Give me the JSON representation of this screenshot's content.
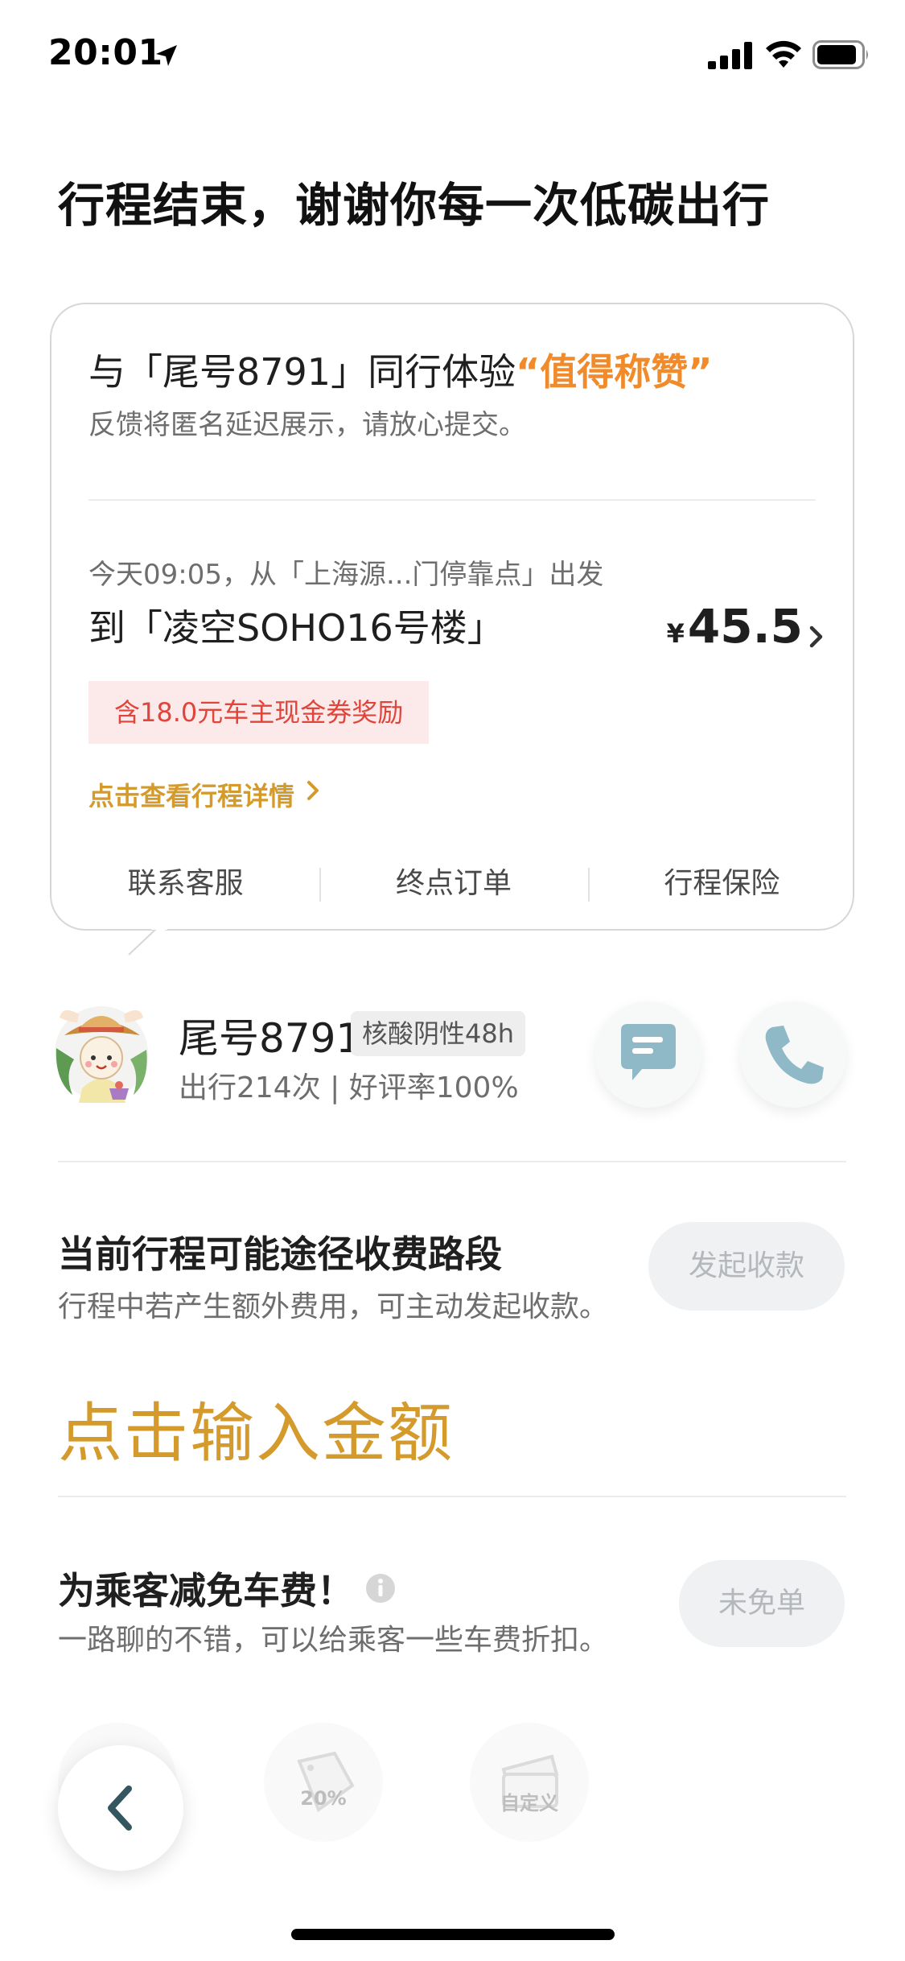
{
  "status_bar": {
    "time": "20:01",
    "icons": [
      "location-arrow-icon",
      "signal-icon",
      "wifi-icon",
      "battery-icon"
    ]
  },
  "page": {
    "title": "行程结束，谢谢你每一次低碳出行"
  },
  "trip_card": {
    "review_prefix": "与「尾号8791」同行体验",
    "review_highlight": "“值得称赞”",
    "review_note": "反馈将匿名延迟展示，请放心提交。",
    "departure": "今天09:05，从「上海源...门停靠点」出发",
    "destination": "到「凌空SOHO16号楼」",
    "price_currency": "¥",
    "price_value": "45.5",
    "coupon_note": "含18.0元车主现金券奖励",
    "detail_link": "点击查看行程详情",
    "actions": [
      "联系客服",
      "终点订单",
      "行程保险"
    ]
  },
  "driver": {
    "name": "尾号8791",
    "badge": "核酸阴性48h",
    "stats": "出行214次 | 好评率100%"
  },
  "toll": {
    "title": "当前行程可能途径收费路段",
    "subtitle": "行程中若产生额外费用，可主动发起收款。",
    "button": "发起收款",
    "enter_amount": "点击输入金额"
  },
  "discount": {
    "title": "为乘客减免车费！",
    "subtitle": "一路聊的不错，可以给乘客一些车费折扣。",
    "button": "未免单",
    "options": [
      "",
      "20%",
      "自定义"
    ]
  },
  "colors": {
    "accent_gold": "#d49b2c",
    "highlight_orange": "#f08a2a",
    "coupon_red": "#e0453c",
    "coupon_bg": "#fce9e9",
    "icon_teal": "#8fb9c6"
  }
}
